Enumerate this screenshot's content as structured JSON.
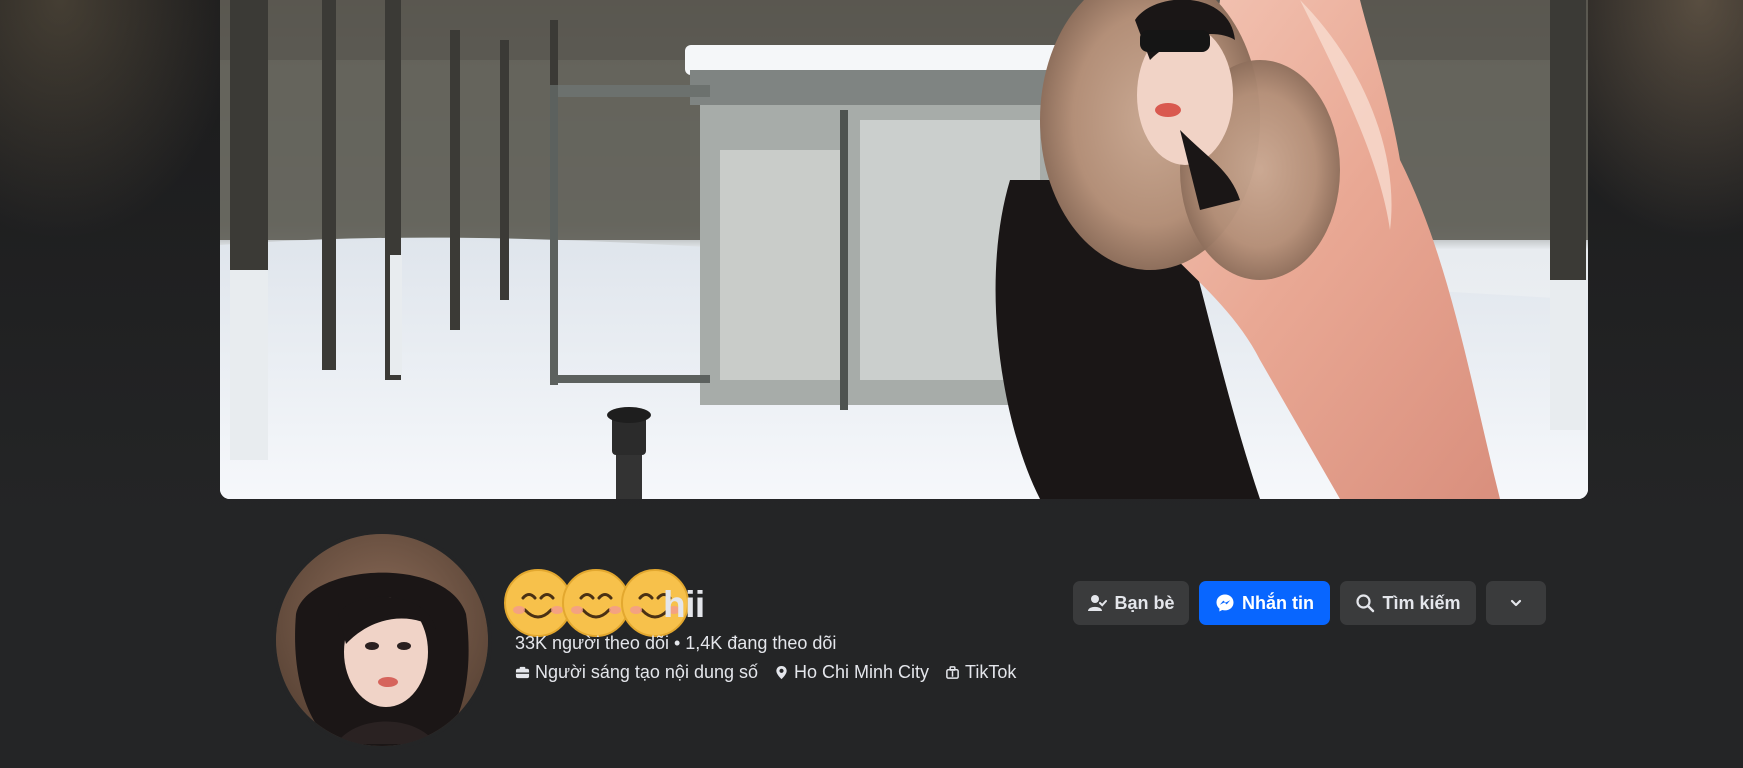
{
  "profile": {
    "name_visible": "hii",
    "followers_text": "33K người theo dõi • 1,4K đang theo dõi",
    "details": [
      {
        "icon": "creator-icon",
        "label": "Người sáng tạo nội dung số"
      },
      {
        "icon": "location-pin-icon",
        "label": "Ho Chi Minh City"
      },
      {
        "icon": "tiktok-icon",
        "label": "TikTok"
      }
    ]
  },
  "actions": {
    "friends_label": "Bạn bè",
    "message_label": "Nhắn tin",
    "search_label": "Tìm kiếm",
    "more_icon": "chevron-down-icon"
  },
  "colors": {
    "background": "#242526",
    "button_secondary": "#3a3b3c",
    "button_primary": "#0866ff",
    "text": "#e4e6eb"
  },
  "cover": {
    "description_icon": "cover-photo"
  }
}
